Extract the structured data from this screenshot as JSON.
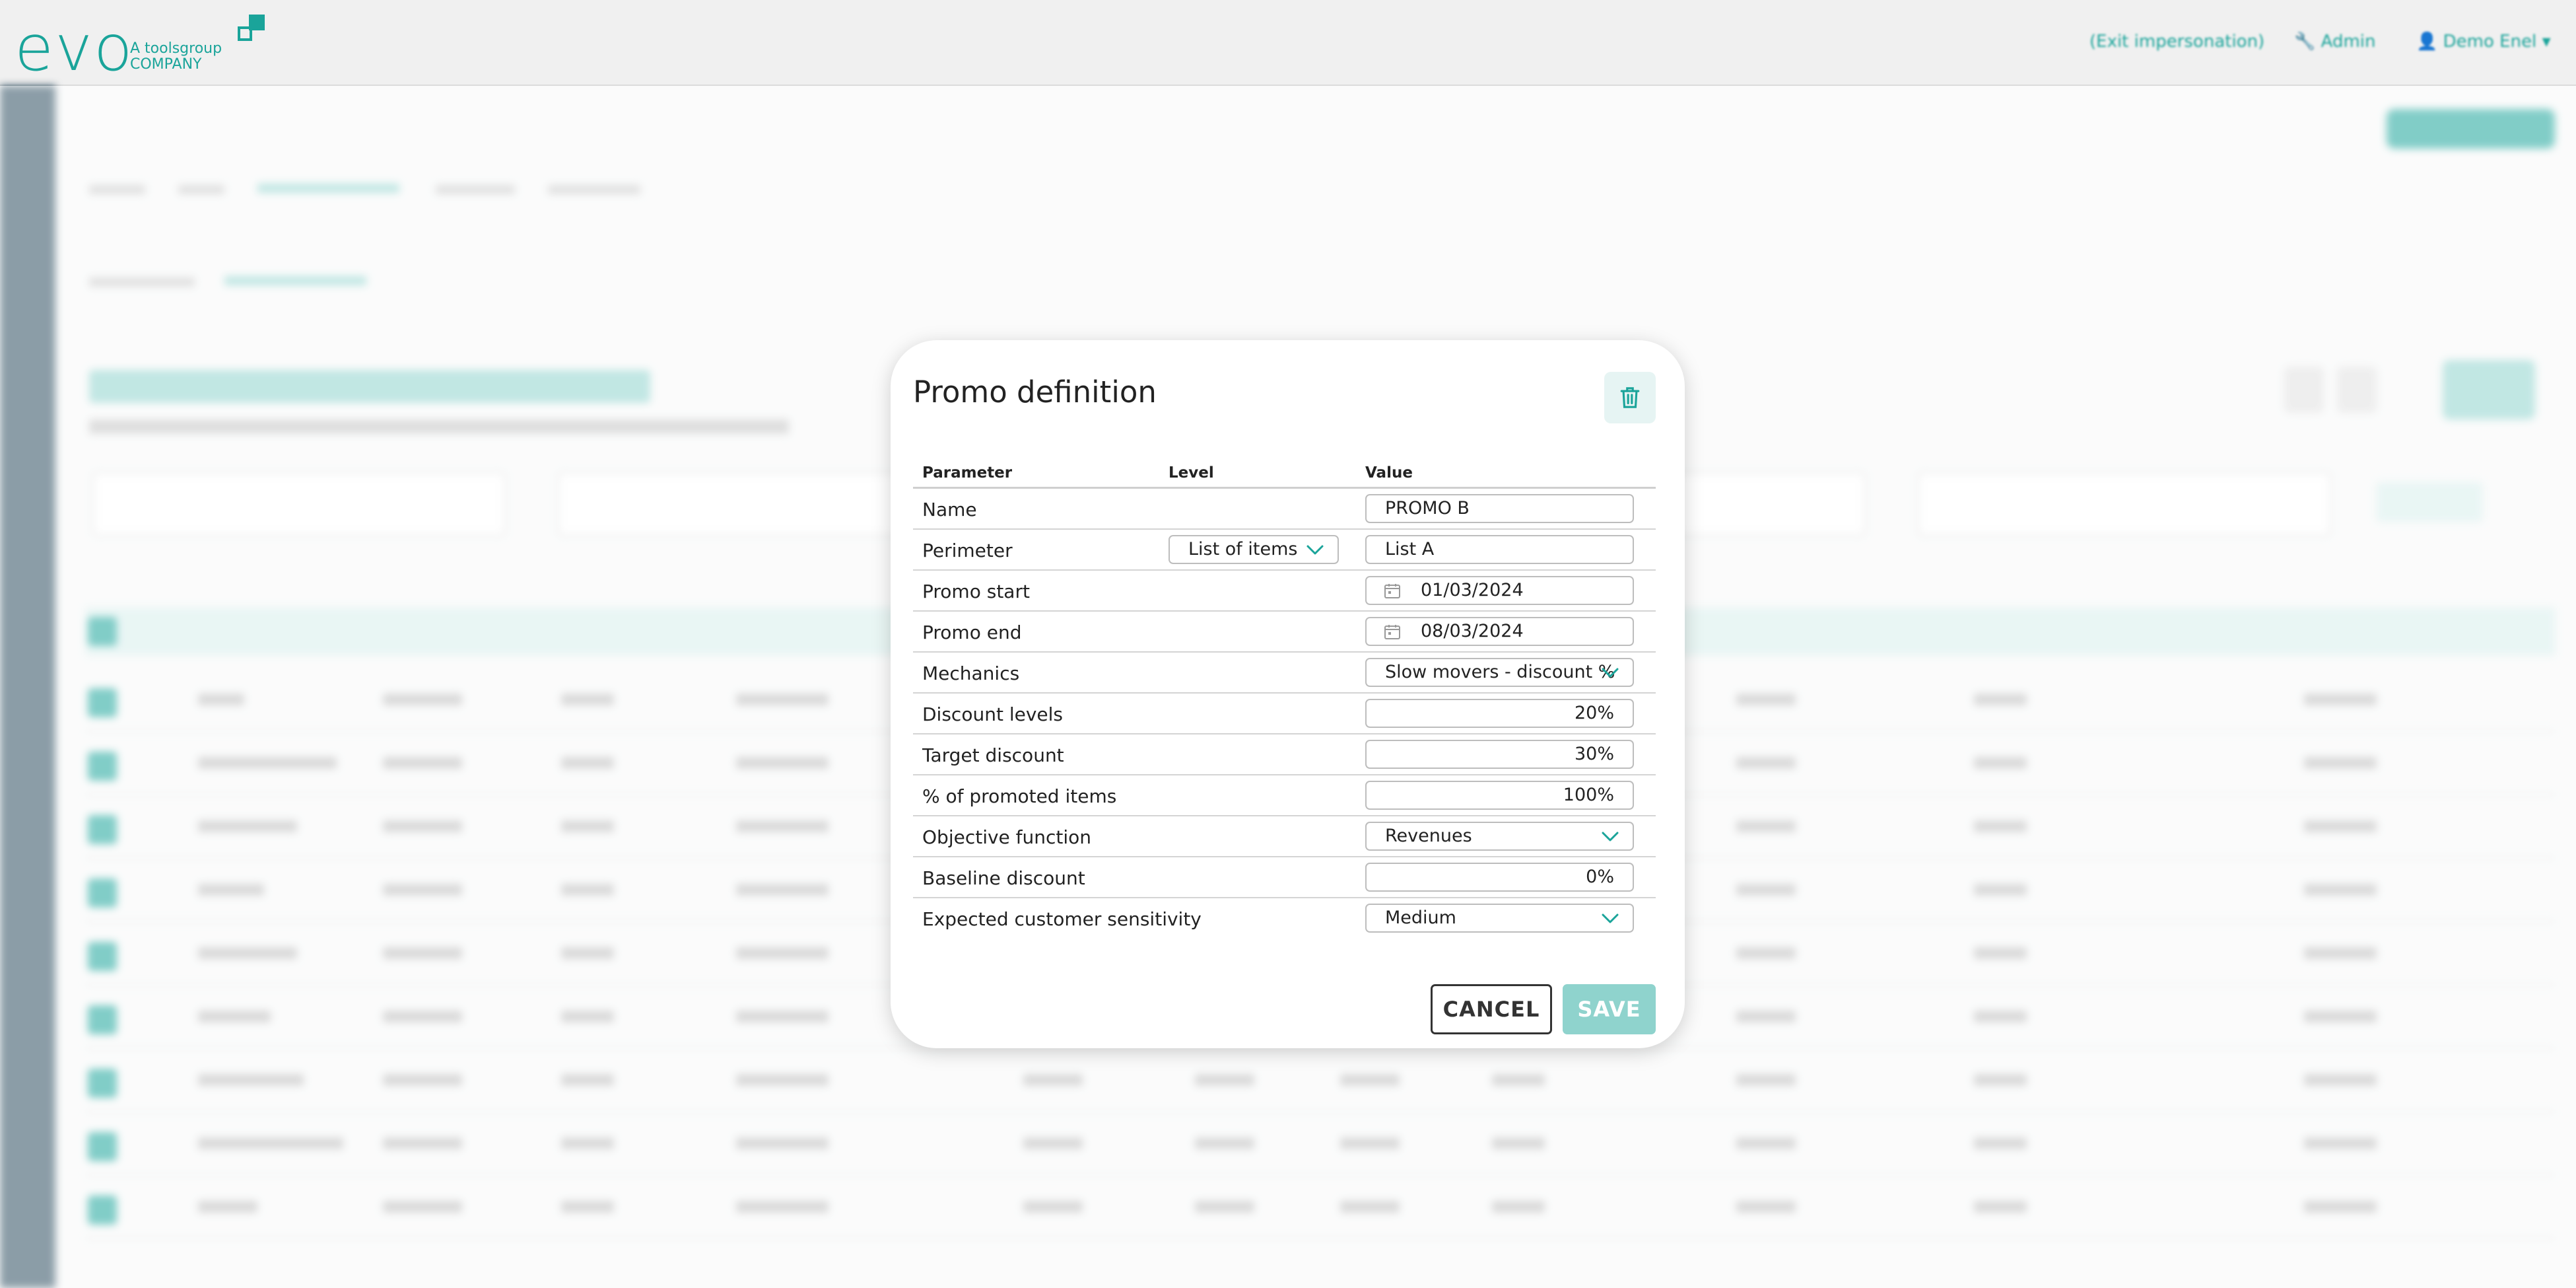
{
  "header": {
    "logo_text": "evo",
    "logo_tagline_1": "A toolsgroup",
    "logo_tagline_2": "COMPANY",
    "exit_impersonation": "(Exit impersonation)",
    "admin_label": "Admin",
    "user_label": "Demo Enel"
  },
  "modal": {
    "title": "Promo definition",
    "columns": {
      "parameter": "Parameter",
      "level": "Level",
      "value": "Value"
    },
    "rows": [
      {
        "label": "Name",
        "value": "PROMO B"
      },
      {
        "label": "Perimeter",
        "level": "List of items",
        "value": "List A"
      },
      {
        "label": "Promo start",
        "value": "01/03/2024"
      },
      {
        "label": "Promo end",
        "value": "08/03/2024"
      },
      {
        "label": "Mechanics",
        "value": "Slow movers - discount %"
      },
      {
        "label": "Discount levels",
        "value": "20%"
      },
      {
        "label": "Target discount",
        "value": "30%"
      },
      {
        "label": "% of promoted items",
        "value": "100%"
      },
      {
        "label": "Objective function",
        "value": "Revenues"
      },
      {
        "label": "Baseline discount",
        "value": "0%"
      },
      {
        "label": "Expected customer sensitivity",
        "value": "Medium"
      }
    ],
    "cancel_label": "CANCEL",
    "save_label": "SAVE"
  },
  "colors": {
    "accent": "#1aa49a",
    "accent_light": "#8fd3cd",
    "sidebar": "#2d4d60"
  }
}
